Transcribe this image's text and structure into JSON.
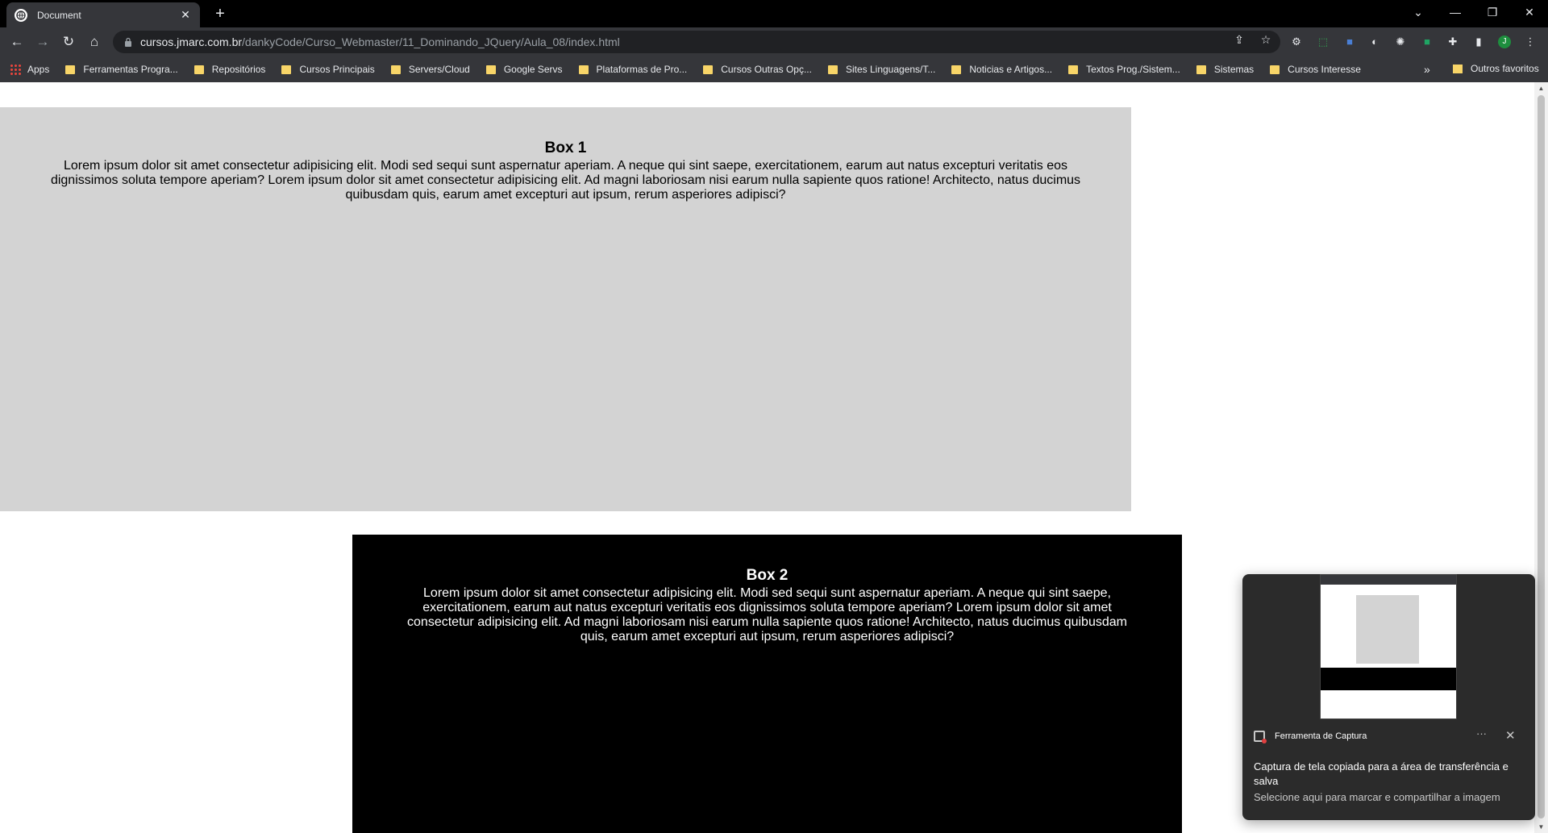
{
  "browser": {
    "tab_title": "Document",
    "url_host": "cursos.jmarc.com.br",
    "url_path": "/dankyCode/Curso_Webmaster/11_Dominando_JQuery/Aula_08/index.html",
    "new_tab": "+",
    "profile_initial": "J"
  },
  "bookmarks": {
    "apps_label": "Apps",
    "items": [
      "Ferramentas Progra...",
      "Repositórios",
      "Cursos Principais",
      "Servers/Cloud",
      "Google Servs",
      "Plataformas de Pro...",
      "Cursos Outras Opç...",
      "Sites Linguagens/T...",
      "Noticias e Artigos...",
      "Textos Prog./Sistem...",
      "Sistemas",
      "Cursos Interesse"
    ],
    "more": "»",
    "other_favorites": "Outros favoritos"
  },
  "page": {
    "box1": {
      "title": "Box 1",
      "text": "Lorem ipsum dolor sit amet consectetur adipisicing elit. Modi sed sequi sunt aspernatur aperiam. A neque qui sint saepe, exercitationem, earum aut natus excepturi veritatis eos dignissimos soluta tempore aperiam? Lorem ipsum dolor sit amet consectetur adipisicing elit. Ad magni laboriosam nisi earum nulla sapiente quos ratione! Architecto, natus ducimus quibusdam quis, earum amet excepturi aut ipsum, rerum asperiores adipisci?",
      "background": "#d3d3d3"
    },
    "box2": {
      "title": "Box 2",
      "text": "Lorem ipsum dolor sit amet consectetur adipisicing elit. Modi sed sequi sunt aspernatur aperiam. A neque qui sint saepe, exercitationem, earum aut natus excepturi veritatis eos dignissimos soluta tempore aperiam? Lorem ipsum dolor sit amet consectetur adipisicing elit. Ad magni laboriosam nisi earum nulla sapiente quos ratione! Architecto, natus ducimus quibusdam quis, earum amet excepturi aut ipsum, rerum asperiores adipisci?",
      "background": "#000000"
    }
  },
  "toast": {
    "app_name": "Ferramenta de Captura",
    "message": "Captura de tela copiada para a área de transferência e salva",
    "sub": "Selecione aqui para marcar e compartilhar a imagem",
    "more": "···",
    "close": "✕"
  }
}
